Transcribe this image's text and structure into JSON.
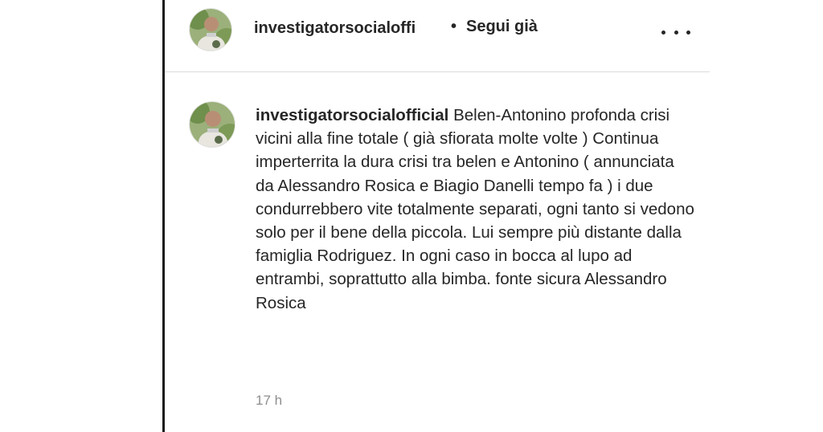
{
  "post": {
    "header": {
      "username": "investigatorsocialoffi",
      "separator": "•",
      "follow_label": "Segui già",
      "more_icon": "more-horizontal-icon"
    },
    "comment": {
      "username": "investigatorsocialofficial",
      "text": "Belen-Antonino profonda crisi vicini alla fine totale ( già sfiorata molte volte ) Continua imperterrita la dura crisi tra belen e Antonino ( annunciata da Alessandro Rosica e Biagio Danelli tempo fa ) i due condurrebbero vite totalmente separati, ogni tanto si vedono solo per il bene della piccola. Lui sempre più distante dalla famiglia Rodriguez. In ogni caso in bocca al lupo ad entrambi, soprattutto alla bimba. fonte sicura Alessandro Rosica",
      "timestamp": "17 h"
    }
  }
}
